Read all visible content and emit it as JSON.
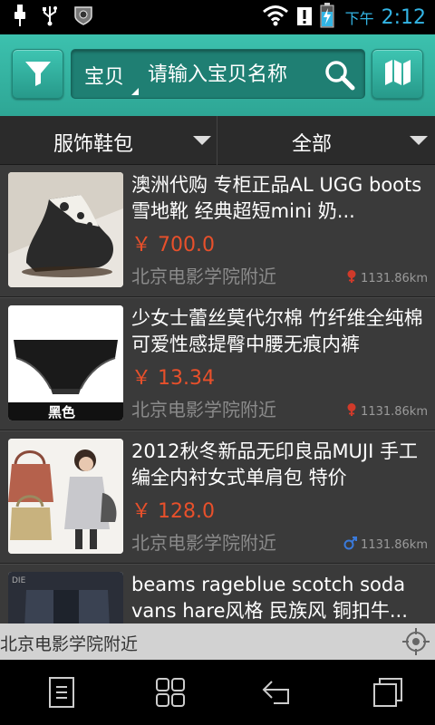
{
  "status_bar": {
    "ampm": "下午",
    "time": "2:12",
    "icons": [
      "usb-icon",
      "usb-debug-icon",
      "security-shield-icon",
      "wifi-icon",
      "alert-icon",
      "battery-charging-icon"
    ]
  },
  "header": {
    "search_type": "宝贝",
    "search_placeholder": "请输入宝贝名称",
    "icons": [
      "filter-icon",
      "search-icon",
      "map-icon"
    ]
  },
  "filters": {
    "category": "服饰鞋包",
    "scope": "全部"
  },
  "items": [
    {
      "title": "澳洲代购 专柜正品AL UGG boots雪地靴 经典超短mini 奶...",
      "price": "￥ 700.0",
      "location": "北京电影学院附近",
      "distance": "1131.86km",
      "gender_icon": "female-icon"
    },
    {
      "title": "少女士蕾丝莫代尔棉 竹纤维全纯棉可爱性感提臀中腰无痕内裤",
      "price": "￥ 13.34",
      "location": "北京电影学院附近",
      "distance": "1131.86km",
      "gender_icon": "female-icon",
      "thumb_caption": "黑色"
    },
    {
      "title": "2012秋冬新品无印良品MUJI 手工编全内衬女式单肩包 特价",
      "price": "￥ 128.0",
      "location": "北京电影学院附近",
      "distance": "1131.86km",
      "gender_icon": "male-icon"
    },
    {
      "title": "beams rageblue scotch soda vans hare风格 民族风 铜扣牛...",
      "price": "",
      "location": "",
      "distance": "",
      "gender_icon": ""
    }
  ],
  "location_bar": {
    "text": "北京电影学院附近"
  },
  "colors": {
    "accent": "#33b5a3",
    "price": "#e8502b",
    "clock": "#33b5e5"
  }
}
